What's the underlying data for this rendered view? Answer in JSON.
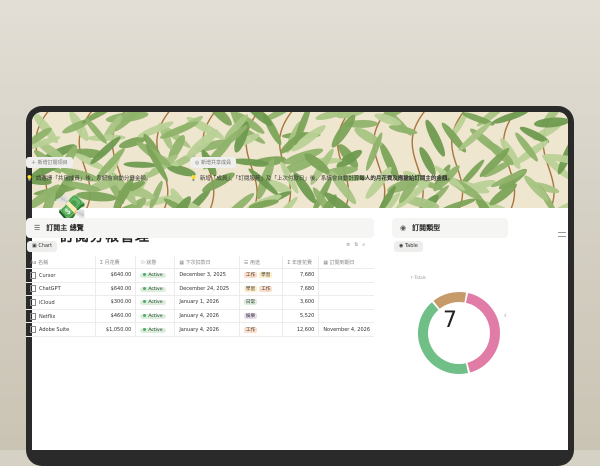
{
  "page": {
    "icon": "money-with-wings-icon",
    "title": "訂閱分帳管理"
  },
  "callouts": [
    {
      "button": "新增訂閱項目",
      "text": "請選擇「共用成員」後，系統會自動分攤金額。",
      "bold": ""
    },
    {
      "button": "新增共享成員",
      "text": "新增「成員」、「訂閱服務」及「上次付款日」後，系統會自動計算",
      "bold": "每人的月花費及應繳給訂閱主的金額。"
    }
  ],
  "sections": {
    "main": {
      "title": "訂閱主 總覽",
      "view": "Chart"
    },
    "side": {
      "title": "訂閱類型",
      "view": "Table",
      "chart_label": "↑-Totals",
      "side_label": "4"
    }
  },
  "table": {
    "headers": [
      "名稱",
      "月花費",
      "狀態",
      "下次扣款日",
      "用途",
      "年度花費",
      "訂閱到期日"
    ],
    "rows": [
      {
        "name": "Cursor",
        "monthly": "$640.00",
        "status": "Active",
        "next": "December 3, 2025",
        "tags": [
          "工作",
          "學習"
        ],
        "yearly": "7,680",
        "expire": ""
      },
      {
        "name": "ChatGPT",
        "monthly": "$640.00",
        "status": "Active",
        "next": "December 24, 2025",
        "tags": [
          "學習",
          "工作"
        ],
        "yearly": "7,680",
        "expire": ""
      },
      {
        "name": "iCloud",
        "monthly": "$300.00",
        "status": "Active",
        "next": "January 1, 2026",
        "tags": [
          "日常"
        ],
        "yearly": "3,600",
        "expire": ""
      },
      {
        "name": "Netflix",
        "monthly": "$460.00",
        "status": "Active",
        "next": "January 4, 2026",
        "tags": [
          "娛樂"
        ],
        "yearly": "5,520",
        "expire": ""
      },
      {
        "name": "Adobe Suite",
        "monthly": "$1,050.00",
        "status": "Active",
        "next": "January 4, 2026",
        "tags": [
          "工作"
        ],
        "yearly": "12,600",
        "expire": "November 4, 2026"
      }
    ]
  },
  "tag_colors": {
    "工作": "#fadec9",
    "學習": "#fdecc8",
    "日常": "#dbeddb",
    "娛樂": "#e8deee"
  },
  "chart_data": {
    "type": "pie",
    "total_label": "7",
    "slices": [
      {
        "color": "#e07ca5",
        "value": 3
      },
      {
        "color": "#6fbf87",
        "value": 3
      },
      {
        "color": "#c79a6a",
        "value": 1
      }
    ]
  }
}
